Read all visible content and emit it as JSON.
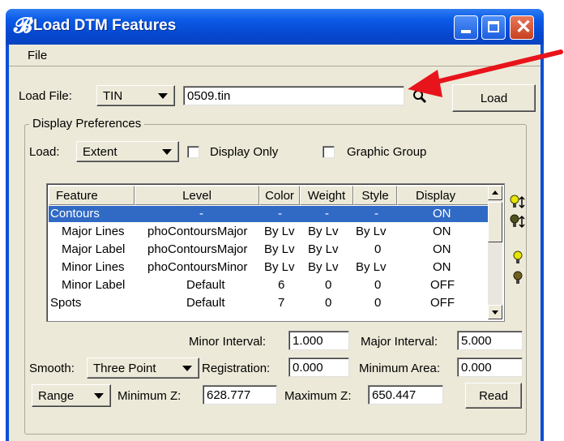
{
  "window": {
    "title": "Load DTM Features",
    "icon": "bentley-b-icon"
  },
  "menu": {
    "file": "File"
  },
  "load_file": {
    "label": "Load File:",
    "type_value": "TIN",
    "file_value": "0509.tin",
    "search_icon": "magnifier-icon",
    "load_button": "Load"
  },
  "display_prefs": {
    "group_title": "Display Preferences",
    "load_label": "Load:",
    "load_value": "Extent",
    "display_only_label": "Display Only",
    "graphic_group_label": "Graphic Group"
  },
  "table": {
    "columns": [
      "Feature",
      "Level",
      "Color",
      "Weight",
      "Style",
      "Display"
    ],
    "rows": [
      {
        "feature": "Contours",
        "level": "-",
        "color": "-",
        "weight": "-",
        "style": "-",
        "display": "ON",
        "selected": true
      },
      {
        "feature": "Major Lines",
        "level": "phoContoursMajor",
        "color": "By Lv",
        "weight": "By Lv",
        "style": "By Lv",
        "display": "ON"
      },
      {
        "feature": "Major Label",
        "level": "phoContoursMajor",
        "color": "By Lv",
        "weight": "By Lv",
        "style": "0",
        "display": "ON"
      },
      {
        "feature": "Minor Lines",
        "level": "phoContoursMinor",
        "color": "By Lv",
        "weight": "By Lv",
        "style": "By Lv",
        "display": "ON"
      },
      {
        "feature": "Minor Label",
        "level": "Default",
        "color": "6",
        "weight": "0",
        "style": "0",
        "display": "OFF"
      },
      {
        "feature": "Spots",
        "level": "Default",
        "color": "7",
        "weight": "0",
        "style": "0",
        "display": "OFF"
      }
    ]
  },
  "side_icons": [
    "bulb-on-toggle-icon",
    "bulb-toggle-icon",
    "bulb-on-icon",
    "bulb-off-icon"
  ],
  "intervals": {
    "minor_label": "Minor Interval:",
    "minor_value": "1.000",
    "major_label": "Major Interval:",
    "major_value": "5.000"
  },
  "smooth": {
    "label": "Smooth:",
    "value": "Three Point",
    "registration_label": "Registration:",
    "registration_value": "0.000",
    "min_area_label": "Minimum Area:",
    "min_area_value": "0.000"
  },
  "range": {
    "value": "Range",
    "min_z_label": "Minimum Z:",
    "min_z_value": "628.777",
    "max_z_label": "Maximum Z:",
    "max_z_value": "650.447",
    "read_button": "Read"
  },
  "colors": {
    "title_blue": "#0b5be6",
    "selection": "#316ac5",
    "arrow_red": "#e8141b",
    "face": "#ece9d8"
  }
}
